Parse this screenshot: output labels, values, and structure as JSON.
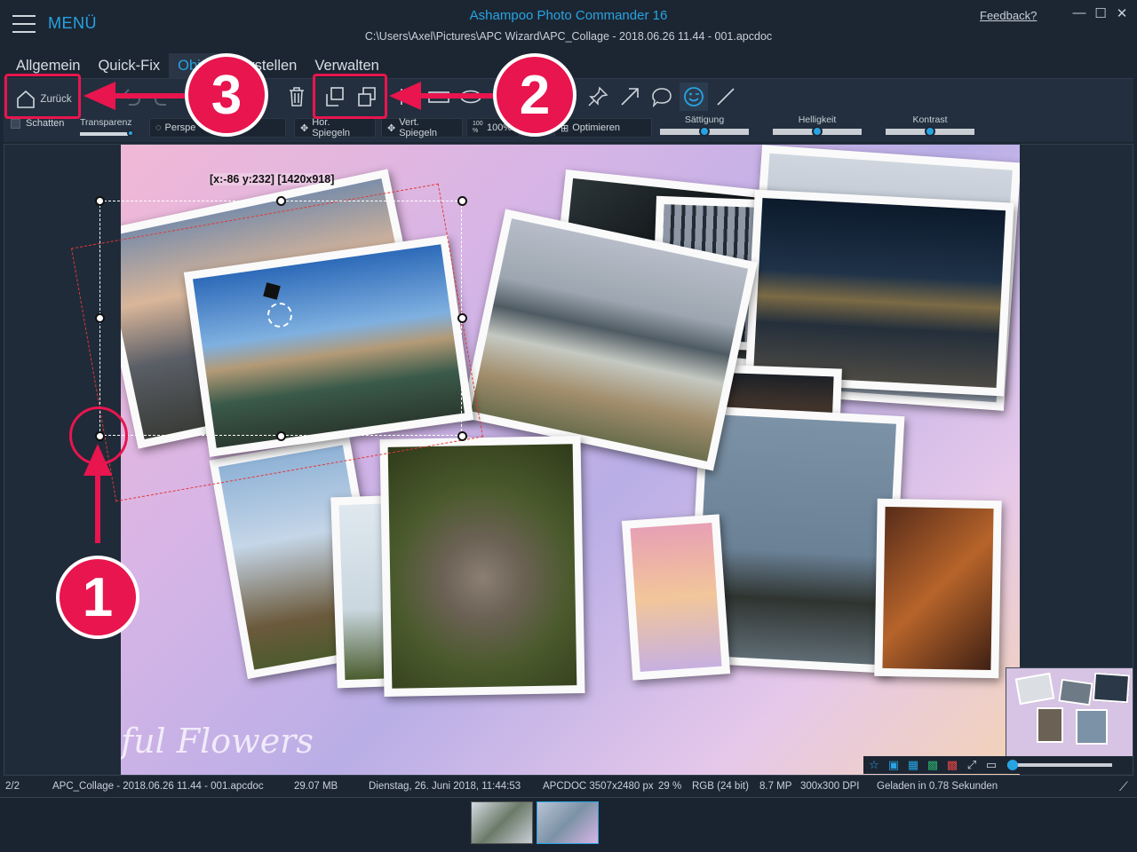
{
  "header": {
    "menu_label": "MENÜ",
    "app_title": "Ashampoo Photo Commander 16",
    "document_path": "C:\\Users\\Axel\\Pictures\\APC Wizard\\APC_Collage - 2018.06.26 11.44 - 001.apcdoc",
    "feedback_link": "Feedback?",
    "minimize": "—",
    "maximize": "☐",
    "close": "✕"
  },
  "tabs": [
    {
      "label": "Allgemein"
    },
    {
      "label": "Quick-Fix"
    },
    {
      "label": "Obj"
    },
    {
      "label": "Erstellen"
    },
    {
      "label": "Verwalten"
    }
  ],
  "toolbar": {
    "back_label": "Zurück",
    "shadow_label": "Schatten",
    "transparency_label": "Transparenz",
    "perspective_label": "Perspe",
    "hflip_label": "Hor. Spiegeln",
    "vflip_label": "Vert. Spiegeln",
    "zoom_label": "100%",
    "zoom_icon_text": "100 %",
    "optimize_label": "Optimieren",
    "saturation_label": "Sättigung",
    "brightness_label": "Helligkeit",
    "contrast_label": "Kontrast",
    "sliders": {
      "saturation": 0.5,
      "brightness": 0.5,
      "contrast": 0.5,
      "transparency": 0.95
    }
  },
  "canvas": {
    "selection_readout": "[x:-86 y:232] [1420x918]",
    "watermark_text": "ful Flowers"
  },
  "annotations": {
    "badge_1": "1",
    "badge_2": "2",
    "badge_3": "3",
    "accent_color": "#e8154e"
  },
  "statusbar": {
    "page": "2/2",
    "filename": "APC_Collage - 2018.06.26 11.44 - 001.apcdoc",
    "filesize": "29.07 MB",
    "date": "Dienstag, 26. Juni 2018, 11:44:53",
    "format": "APCDOC 3507x2480 px",
    "zoom": "29 %",
    "color": "RGB (24 bit)",
    "megapixels": "8.7 MP",
    "dpi": "300x300 DPI",
    "load_time": "Geladen in 0.78 Sekunden"
  },
  "colors": {
    "accent_blue": "#27a3e2",
    "background": "#1c2633"
  }
}
